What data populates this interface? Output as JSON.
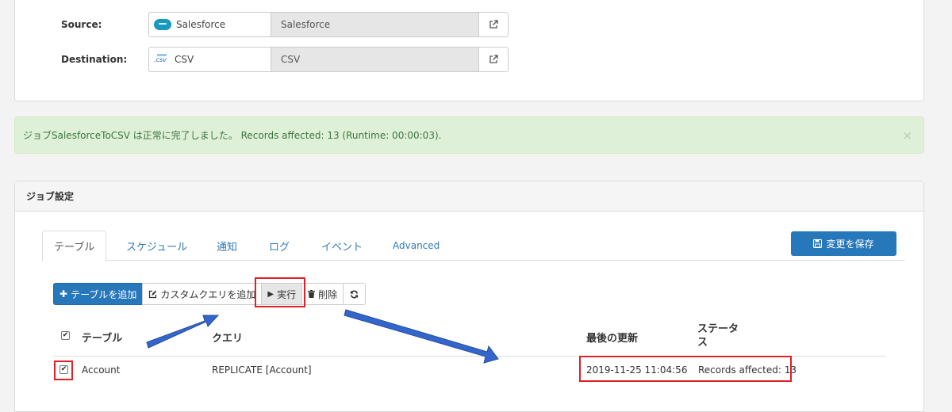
{
  "connections": {
    "source": {
      "label": "Source:",
      "provider": "Salesforce",
      "value": "Salesforce",
      "icon": "salesforce-icon"
    },
    "destination": {
      "label": "Destination:",
      "provider": "CSV",
      "value": "CSV",
      "icon": "csv-icon",
      "icon_text": ".csv"
    }
  },
  "alert": {
    "message": "ジョブSalesforceToCSV は正常に完了しました。 Records affected: 13 (Runtime: 00:00:03).",
    "close": "×"
  },
  "job_settings": {
    "title": "ジョブ設定",
    "tabs": [
      {
        "label": "テーブル",
        "active": true
      },
      {
        "label": "スケジュール"
      },
      {
        "label": "通知"
      },
      {
        "label": "ログ"
      },
      {
        "label": "イベント"
      },
      {
        "label": "Advanced"
      }
    ],
    "save_button": "変更を保存",
    "toolbar": {
      "add_table": "テーブルを追加",
      "add_custom_query": "カスタムクエリを追加",
      "run": "実行",
      "delete": "削除"
    },
    "table": {
      "headers": {
        "table": "テーブル",
        "query": "クエリ",
        "last_updated": "最後の更新",
        "status_line1": "ステータ",
        "status_line2": "ス"
      },
      "rows": [
        {
          "table": "Account",
          "query": "REPLICATE [Account]",
          "last_updated": "2019-11-25 11:04:56",
          "status": "Records affected: 13",
          "checked": true
        }
      ]
    }
  },
  "colors": {
    "primary": "#2777bb",
    "alert_bg": "#dff0d8",
    "alert_text": "#3c763d",
    "annotation_red": "#e01f26",
    "annotation_arrow": "#3366cc"
  }
}
